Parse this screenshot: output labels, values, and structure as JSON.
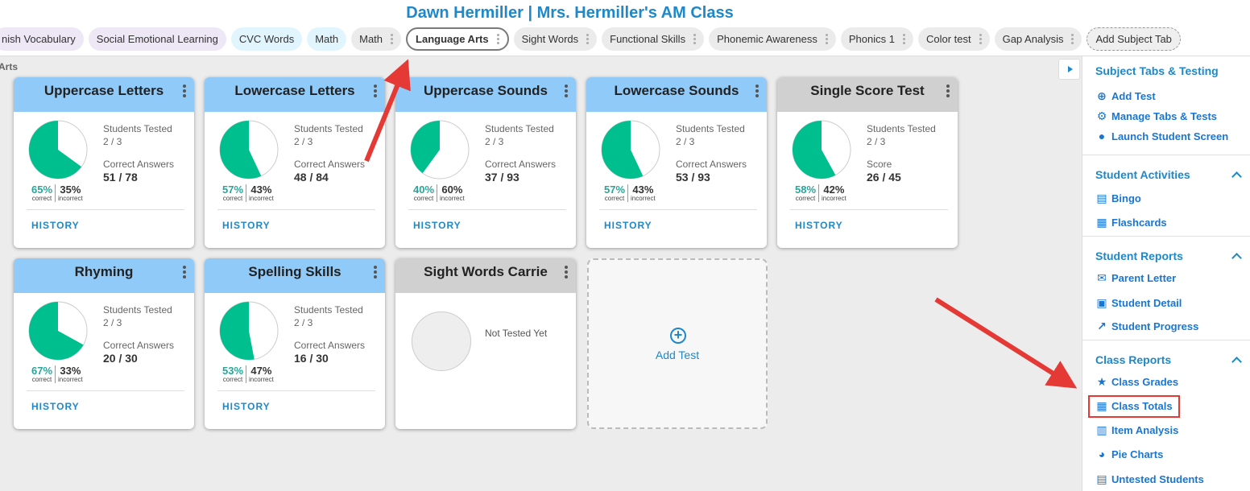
{
  "header": {
    "title": "Dawn Hermiller | Mrs. Hermiller's AM Class"
  },
  "tabs": [
    {
      "label": "nish Vocabulary",
      "style": "purple",
      "menu": false
    },
    {
      "label": "Social Emotional Learning",
      "style": "purple",
      "menu": false
    },
    {
      "label": "CVC Words",
      "style": "blue",
      "menu": false
    },
    {
      "label": "Math",
      "style": "blue",
      "menu": false
    },
    {
      "label": "Math",
      "style": "grey",
      "menu": true
    },
    {
      "label": "Language Arts",
      "style": "active",
      "menu": true
    },
    {
      "label": "Sight Words",
      "style": "grey",
      "menu": true
    },
    {
      "label": "Functional Skills",
      "style": "grey",
      "menu": true
    },
    {
      "label": "Phonemic Awareness",
      "style": "grey",
      "menu": true
    },
    {
      "label": "Phonics 1",
      "style": "grey",
      "menu": true
    },
    {
      "label": "Color test",
      "style": "grey",
      "menu": true
    },
    {
      "label": "Gap Analysis",
      "style": "grey",
      "menu": true
    },
    {
      "label": "Add Subject Tab",
      "style": "add",
      "menu": false
    }
  ],
  "breadcrumb": "Arts",
  "cards": [
    {
      "title": "Uppercase Letters",
      "tested_label": "Students Tested",
      "tested": "2 / 3",
      "result_label": "Correct Answers",
      "result": "51 / 78",
      "correct_pct": "65%",
      "incorrect_pct": "35%",
      "correct_fraction": 0.65,
      "history": "HISTORY"
    },
    {
      "title": "Lowercase Letters",
      "tested_label": "Students Tested",
      "tested": "2 / 3",
      "result_label": "Correct Answers",
      "result": "48 / 84",
      "correct_pct": "57%",
      "incorrect_pct": "43%",
      "correct_fraction": 0.57,
      "history": "HISTORY"
    },
    {
      "title": "Uppercase Sounds",
      "tested_label": "Students Tested",
      "tested": "2 / 3",
      "result_label": "Correct Answers",
      "result": "37 / 93",
      "correct_pct": "40%",
      "incorrect_pct": "60%",
      "correct_fraction": 0.4,
      "history": "HISTORY"
    },
    {
      "title": "Lowercase Sounds",
      "tested_label": "Students Tested",
      "tested": "2 / 3",
      "result_label": "Correct Answers",
      "result": "53 / 93",
      "correct_pct": "57%",
      "incorrect_pct": "43%",
      "correct_fraction": 0.57,
      "history": "HISTORY"
    },
    {
      "title": "Single Score Test",
      "tested_label": "Students Tested",
      "tested": "2 / 3",
      "result_label": "Score",
      "result": "26 / 45",
      "correct_pct": "58%",
      "incorrect_pct": "42%",
      "correct_fraction": 0.58,
      "history": "HISTORY",
      "grey": true
    },
    {
      "title": "Rhyming",
      "tested_label": "Students Tested",
      "tested": "2 / 3",
      "result_label": "Correct Answers",
      "result": "20 / 30",
      "correct_pct": "67%",
      "incorrect_pct": "33%",
      "correct_fraction": 0.67,
      "history": "HISTORY"
    },
    {
      "title": "Spelling Skills",
      "tested_label": "Students Tested",
      "tested": "2 / 3",
      "result_label": "Correct Answers",
      "result": "16 / 30",
      "correct_pct": "53%",
      "incorrect_pct": "47%",
      "correct_fraction": 0.53,
      "history": "HISTORY"
    },
    {
      "title": "Sight Words Carrie",
      "untested": true,
      "untested_text": "Not Tested Yet",
      "grey": true
    }
  ],
  "pct_labels": {
    "correct": "correct",
    "incorrect": "incorrect"
  },
  "add_test": {
    "label": "Add Test",
    "icon": "plus-circle-icon"
  },
  "sidebar": {
    "sections": [
      {
        "title": "Subject Tabs & Testing",
        "collapsible": false,
        "items": [
          {
            "label": "Add Test",
            "icon": "plus-circle-icon"
          },
          {
            "label": "Manage Tabs & Tests",
            "icon": "gear-icon"
          },
          {
            "label": "Launch Student Screen",
            "icon": "person-icon"
          }
        ]
      },
      {
        "title": "Student Activities",
        "collapsible": true,
        "items": [
          {
            "label": "Bingo",
            "icon": "clipboard-icon"
          },
          {
            "label": "Flashcards",
            "icon": "grid-icon"
          }
        ]
      },
      {
        "title": "Student Reports",
        "collapsible": true,
        "items": [
          {
            "label": "Parent Letter",
            "icon": "envelope-icon"
          },
          {
            "label": "Student Detail",
            "icon": "badge-icon"
          },
          {
            "label": "Student Progress",
            "icon": "trend-icon"
          }
        ]
      },
      {
        "title": "Class Reports",
        "collapsible": true,
        "items": [
          {
            "label": "Class Grades",
            "icon": "star-icon"
          },
          {
            "label": "Class Totals",
            "icon": "table-icon"
          },
          {
            "label": "Item Analysis",
            "icon": "bar-chart-icon"
          },
          {
            "label": "Pie Charts",
            "icon": "pie-chart-icon"
          },
          {
            "label": "Untested Students",
            "icon": "clipboard-icon"
          }
        ]
      }
    ]
  },
  "colors": {
    "accent": "#1e88c9",
    "correct": "#00bf8f",
    "header_blue": "#90caf9",
    "annotation_red": "#e53935"
  }
}
